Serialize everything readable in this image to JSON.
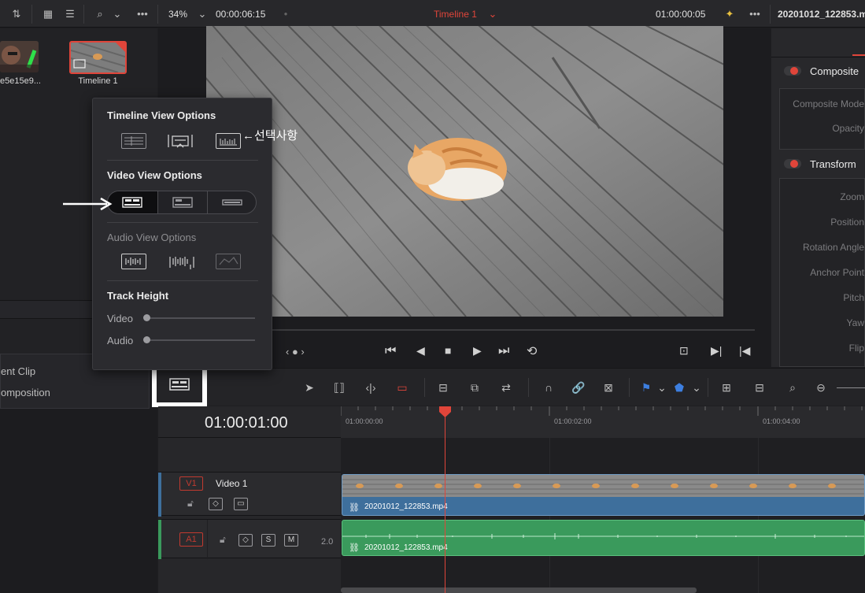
{
  "topbar": {
    "zoom": "34%",
    "source_timecode": "00:00:06:15",
    "timeline_name": "Timeline 1",
    "record_timecode": "01:00:00:05",
    "clip_name": "20201012_122853.m"
  },
  "media_pool": {
    "items": [
      {
        "label": "e5e15e9..."
      },
      {
        "label": "Timeline 1"
      }
    ]
  },
  "left_panel": {
    "rows": [
      "ent Clip",
      "omposition"
    ]
  },
  "inspector": {
    "sections": [
      {
        "label": "Composite",
        "props": [
          "Composite Mode",
          "Opacity"
        ]
      },
      {
        "label": "Transform",
        "props": [
          "Zoom",
          "Position",
          "Rotation Angle",
          "Anchor Point",
          "Pitch",
          "Yaw",
          "Flip"
        ]
      }
    ]
  },
  "popup": {
    "timeline_view_title": "Timeline View Options",
    "annotation": "←선택사항",
    "video_view_title": "Video View Options",
    "audio_view_title": "Audio View Options",
    "track_height_title": "Track Height",
    "video_label": "Video",
    "audio_label": "Audio",
    "video_height_level": 0,
    "audio_height_level": 0
  },
  "timeline": {
    "current_timecode": "01:00:01:00",
    "ruler_marks": [
      "01:00:00:00",
      "01:00:02:00",
      "01:00:04:00"
    ],
    "tracks": [
      {
        "id": "V1",
        "name": "Video 1",
        "clip": "20201012_122853.mp4"
      },
      {
        "id": "A1",
        "level": "2.0",
        "clip": "20201012_122853.mp4",
        "solo": "S",
        "mute": "M"
      }
    ]
  },
  "colors": {
    "accent_red": "#e0453a",
    "video_clip": "#3e6f9c",
    "audio_clip": "#3a9a5c",
    "playhead": "#e0453a"
  }
}
